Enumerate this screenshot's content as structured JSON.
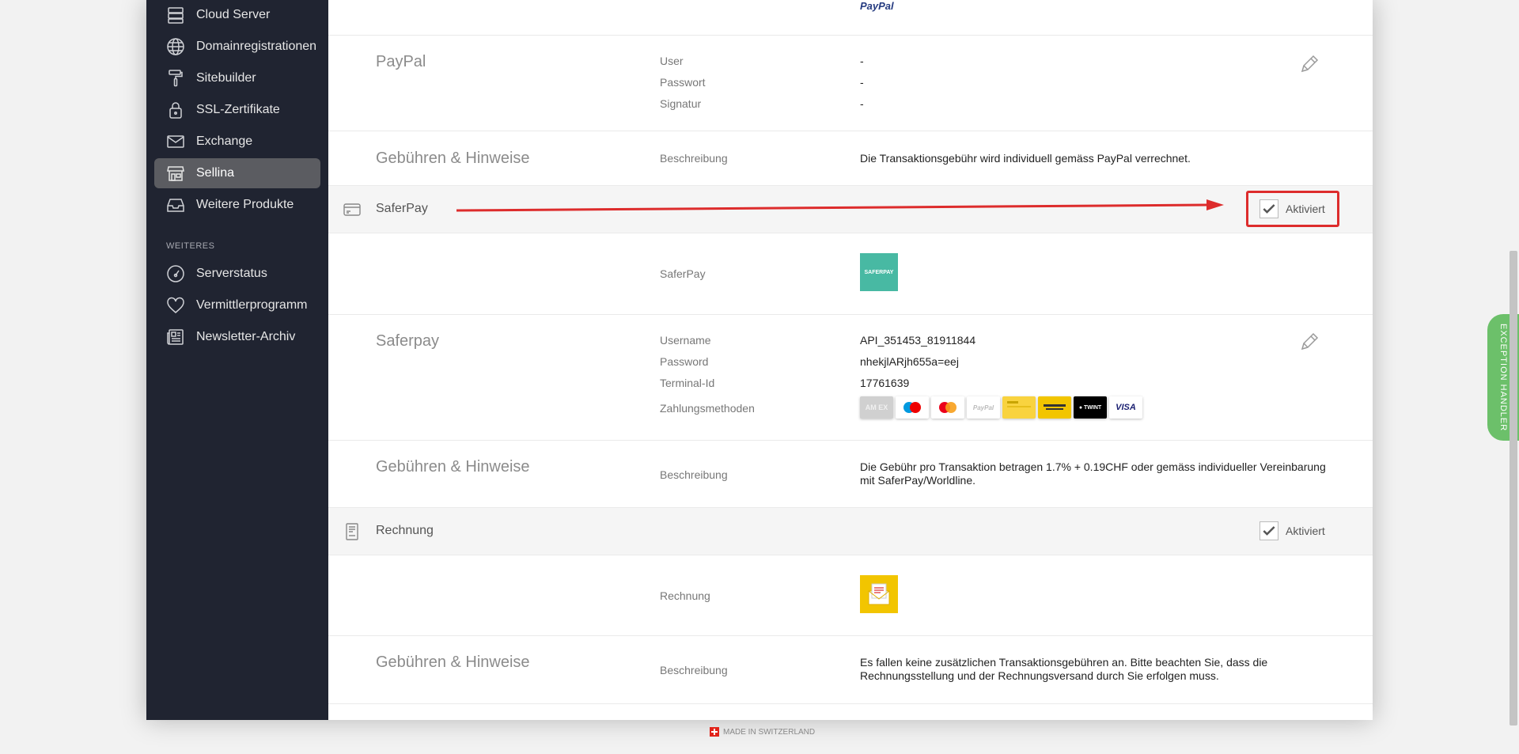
{
  "sidebar": {
    "items": [
      {
        "label": "Cloud Server",
        "icon": "server-icon"
      },
      {
        "label": "Domainregistrationen",
        "icon": "globe-icon"
      },
      {
        "label": "Sitebuilder",
        "icon": "paint-roller-icon"
      },
      {
        "label": "SSL-Zertifikate",
        "icon": "lock-icon"
      },
      {
        "label": "Exchange",
        "icon": "envelope-icon"
      },
      {
        "label": "Sellina",
        "icon": "store-icon",
        "active": true
      },
      {
        "label": "Weitere Produkte",
        "icon": "inbox-icon"
      }
    ],
    "section_label": "WEITERES",
    "more_items": [
      {
        "label": "Serverstatus",
        "icon": "gauge-icon"
      },
      {
        "label": "Vermittlerprogramm",
        "icon": "heart-icon"
      },
      {
        "label": "Newsletter-Archiv",
        "icon": "newspaper-icon"
      }
    ]
  },
  "paypal_top": {
    "logo_text": "PayPal"
  },
  "paypal_credentials": {
    "title": "PayPal",
    "fields": [
      {
        "label": "User",
        "value": "-"
      },
      {
        "label": "Passwort",
        "value": "-"
      },
      {
        "label": "Signatur",
        "value": "-"
      }
    ]
  },
  "paypal_fees": {
    "title": "Gebühren & Hinweise",
    "label": "Beschreibung",
    "value": "Die Transaktionsgebühr wird individuell gemäss PayPal verrechnet."
  },
  "saferpay_header": {
    "name": "SaferPay",
    "checkbox_label": "Aktiviert",
    "checked": true
  },
  "saferpay_logo_row": {
    "label": "SaferPay",
    "logo_text": "SAFERPAY",
    "logo_color": "#48b9a3"
  },
  "saferpay_credentials": {
    "title": "Saferpay",
    "fields": [
      {
        "label": "Username",
        "value": "API_351453_81911844"
      },
      {
        "label": "Password",
        "value": "nhekjlARjh655a=eej"
      },
      {
        "label": "Terminal-Id",
        "value": "17761639"
      }
    ],
    "methods_label": "Zahlungsmethoden",
    "methods": [
      "AMEX",
      "Maestro",
      "Mastercard",
      "PayPal",
      "PostFinance Card",
      "PostFinance E-Finance",
      "TWINT",
      "VISA"
    ]
  },
  "saferpay_fees": {
    "title": "Gebühren & Hinweise",
    "label": "Beschreibung",
    "value_line1": "Die Gebühr pro Transaktion betragen 1.7% + 0.19CHF oder gemäss individueller Vereinbarung",
    "value_line2": "mit SaferPay/Worldline."
  },
  "rechnung_header": {
    "name": "Rechnung",
    "checkbox_label": "Aktiviert",
    "checked": true
  },
  "rechnung_logo_row": {
    "label": "Rechnung"
  },
  "rechnung_fees": {
    "title": "Gebühren & Hinweise",
    "label": "Beschreibung",
    "value_line1": "Es fallen keine zusätzlichen Transaktionsgebühren an. Bitte beachten Sie, dass die",
    "value_line2": "Rechnungsstellung und der Rechnungsversand durch Sie erfolgen muss."
  },
  "footer": {
    "text": "MADE IN SWITZERLAND"
  },
  "exception_tab": {
    "text": "EXCEPTION HANDLER"
  },
  "colors": {
    "sidebar_bg": "#202431",
    "active_item": "#5b5c61",
    "annotation_red": "#dd2c2c",
    "saferpay_teal": "#48b9a3",
    "rechnung_yellow": "#f2c500"
  }
}
